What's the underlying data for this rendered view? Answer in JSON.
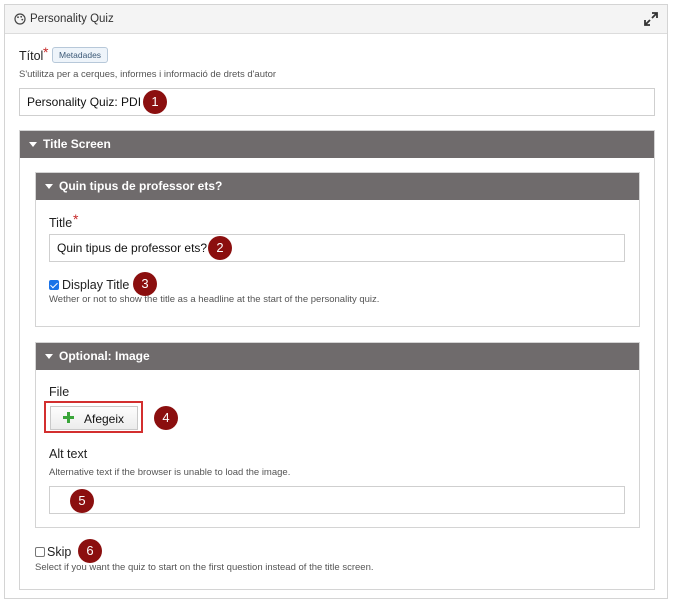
{
  "window": {
    "title": "Personality Quiz"
  },
  "icons": {
    "app": "palette-icon",
    "expand": "expand-arrows-icon",
    "plus": "plus-icon",
    "caret": "caret-down-icon"
  },
  "titol": {
    "label": "Títol",
    "required_mark": "*",
    "badge": "Metadades",
    "help": "S'utilitza per a cerques, informes i informació de drets d'autor",
    "value": "Personality Quiz: PDI"
  },
  "title_screen": {
    "header": "Title Screen",
    "question_section": {
      "header": "Quin tipus de professor ets?",
      "title_label": "Title",
      "required_mark": "*",
      "title_value": "Quin tipus de professor ets?",
      "display_title": {
        "label": "Display Title",
        "checked": true,
        "help": "Wether or not to show the title as a headline at the start of the personality quiz."
      }
    },
    "image_section": {
      "header": "Optional: Image",
      "file_label": "File",
      "add_button": "Afegeix",
      "alt_label": "Alt text",
      "alt_help": "Alternative text if the browser is unable to load the image.",
      "alt_value": ""
    }
  },
  "skip": {
    "label": "Skip",
    "checked": false,
    "help": "Select if you want the quiz to start on the first question instead of the title screen."
  },
  "markers": [
    "1",
    "2",
    "3",
    "4",
    "5",
    "6"
  ],
  "colors": {
    "section_header": "#6f6b6c",
    "marker": "#8b0f0f",
    "highlight": "#d32f2f",
    "plus": "#3aa53a",
    "required": "#c62828"
  }
}
